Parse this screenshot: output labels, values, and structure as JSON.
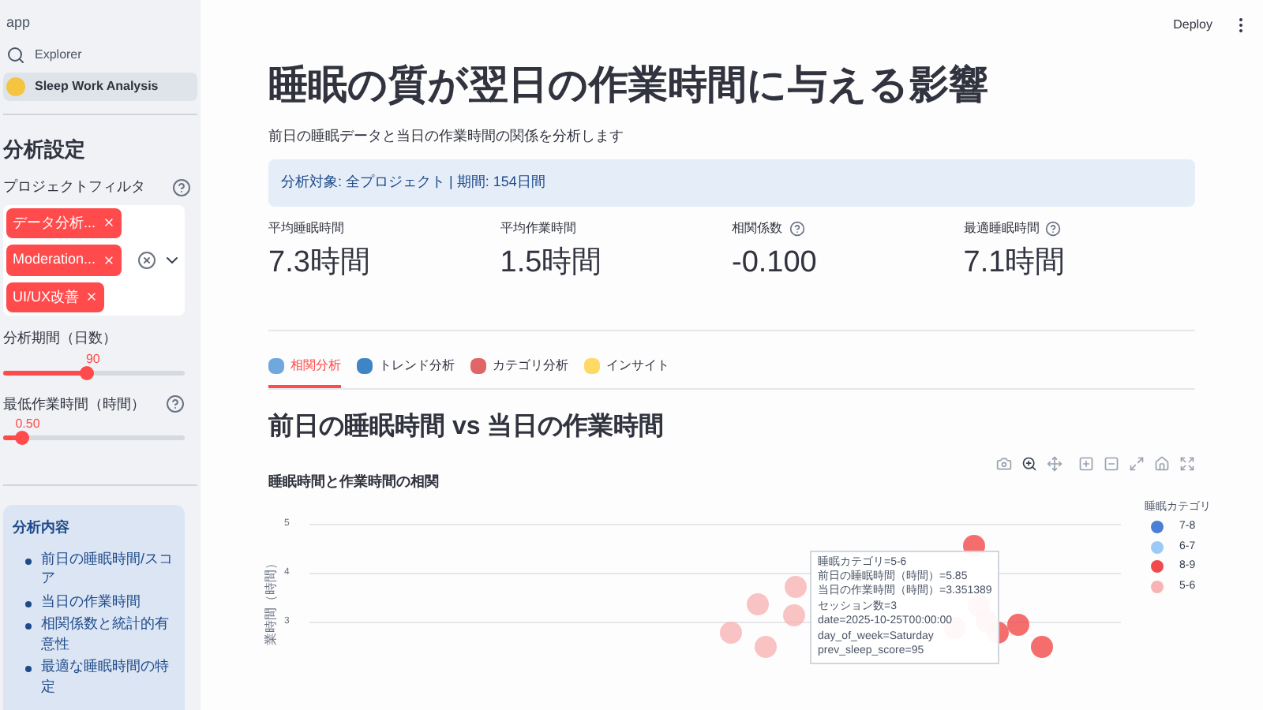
{
  "sidebar": {
    "app_label": "app",
    "nav": [
      {
        "label": "Explorer",
        "selected": false
      },
      {
        "label": "Sleep Work Analysis",
        "selected": true
      }
    ],
    "settings_title": "分析設定",
    "filter": {
      "label": "プロジェクトフィルタ",
      "tags": [
        "データ分析...",
        "Moderation...",
        "UI/UX改善"
      ]
    },
    "sliders": [
      {
        "label": "分析期間（日数）",
        "value": "90",
        "level": 0.46,
        "help": false
      },
      {
        "label": "最低作業時間（時間）",
        "value": "0.50",
        "level": 0.1,
        "help": true
      }
    ],
    "info": {
      "title": "分析内容",
      "items": [
        "前日の睡眠時間/スコア",
        "当日の作業時間",
        "相関係数と統計的有意性",
        "最適な睡眠時間の特定"
      ]
    }
  },
  "header": {
    "deploy": "Deploy"
  },
  "title": "睡眠の質が翌日の作業時間に与える影響",
  "subtitle": "前日の睡眠データと当日の作業時間の関係を分析します",
  "banner": "分析対象: 全プロジェクト | 期間: 154日間",
  "metrics": [
    {
      "label": "平均睡眠時間",
      "value": "7.3時間",
      "help": false
    },
    {
      "label": "平均作業時間",
      "value": "1.5時間",
      "help": false
    },
    {
      "label": "相関係数",
      "value": "-0.100",
      "help": true
    },
    {
      "label": "最適睡眠時間",
      "value": "7.1時間",
      "help": true
    }
  ],
  "tabs": [
    {
      "label": "相関分析",
      "selected": true
    },
    {
      "label": "トレンド分析",
      "selected": false
    },
    {
      "label": "カテゴリ分析",
      "selected": false
    },
    {
      "label": "インサイト",
      "selected": false
    }
  ],
  "section_title": "前日の睡眠時間 vs 当日の作業時間",
  "chart": {
    "title": "睡眠時間と作業時間の相関",
    "ylabel": "業時間（時間）",
    "yticks": [
      "5",
      "4",
      "3"
    ],
    "legend": {
      "title": "睡眠カテゴリ",
      "items": [
        {
          "label": "7-8",
          "color": "#4a7fd4"
        },
        {
          "label": "6-7",
          "color": "#9ccaf7"
        },
        {
          "label": "8-9",
          "color": "#f24a4a"
        },
        {
          "label": "5-6",
          "color": "#f8b4b4"
        }
      ]
    },
    "tooltip": [
      "睡眠カテゴリ=5-6",
      "前日の睡眠時間（時間）=5.85",
      "当日の作業時間（時間）=3.351389",
      "セッション数=3",
      "date=2025-10-25T00:00:00",
      "day_of_week=Saturday",
      "prev_sleep_score=95"
    ]
  }
}
